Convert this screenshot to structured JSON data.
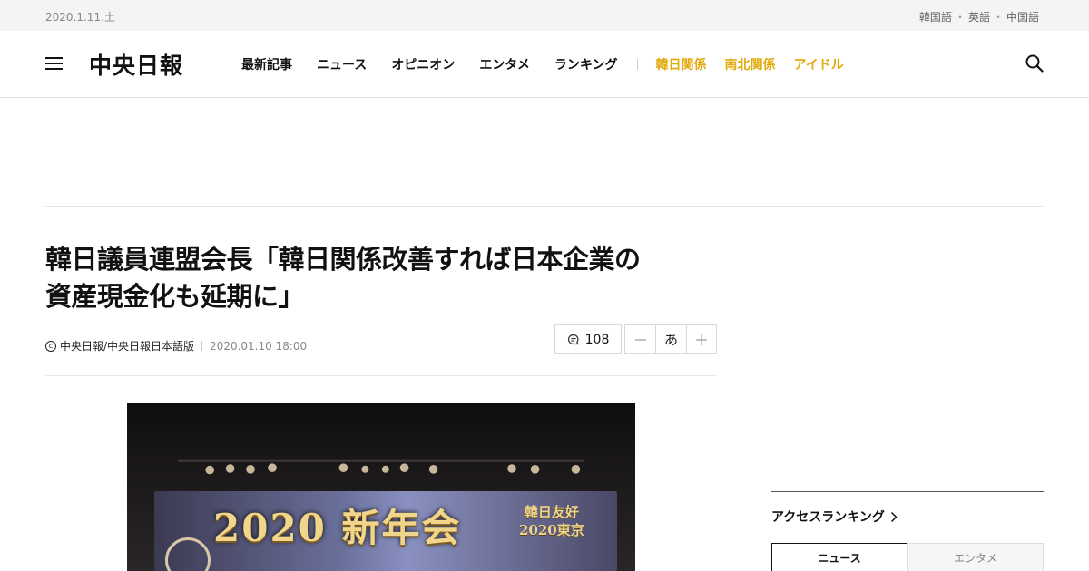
{
  "topbar": {
    "date": "2020.1.11.土",
    "languages": [
      "韓国語",
      "英語",
      "中国語"
    ],
    "separator": "・"
  },
  "header": {
    "logo": "中央日報",
    "nav": [
      "最新記事",
      "ニュース",
      "オピニオン",
      "エンタメ",
      "ランキング"
    ],
    "nav_accent": [
      "韓日関係",
      "南北関係",
      "アイドル"
    ],
    "accent_color": "#e2a90a",
    "icons": {
      "menu": "hamburger-icon",
      "search": "search-icon"
    }
  },
  "article": {
    "title_line1": "韓日議員連盟会長「韓日関係改善すれば日本企業の",
    "title_line2": "資産現金化も延期に」",
    "byline": "中央日報/中央日報日本語版",
    "copyright_symbol": "ⓒ",
    "published": "2020.01.10 18:00",
    "comment_count": "108",
    "font_size_label": "あ",
    "font_decrease": "−",
    "font_increase": "+",
    "photo": {
      "banner_main": "2020 新年会",
      "banner_sub_line1": "韓日友好",
      "banner_sub_line2": "2020東京"
    }
  },
  "sidebar": {
    "ranking_title": "アクセスランキング",
    "tabs": [
      "ニュース",
      "エンタメ"
    ],
    "active_tab": 0
  }
}
